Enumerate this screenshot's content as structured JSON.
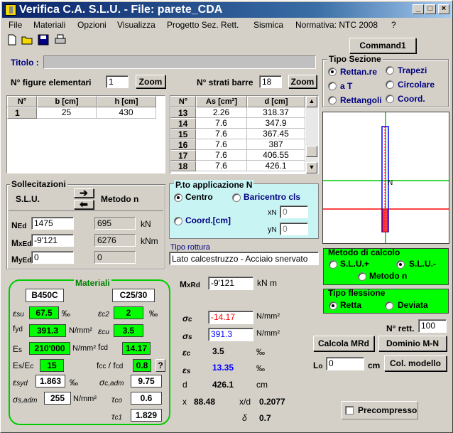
{
  "window": {
    "title": "Verifica C.A. S.L.U. - File: parete_CDA"
  },
  "menu": [
    "File",
    "Materiali",
    "Opzioni",
    "Visualizza",
    "Progetto Sez. Rett.",
    "Sismica",
    "Normativa: NTC 2008",
    "?"
  ],
  "command1": "Command1",
  "titolo_label": "Titolo :",
  "figure": {
    "label": "N° figure elementari",
    "value": "1",
    "zoom": "Zoom",
    "headers": [
      "N°",
      "b [cm]",
      "h [cm]"
    ],
    "rows": [
      [
        "1",
        "25",
        "430"
      ]
    ]
  },
  "strati": {
    "label": "N° strati barre",
    "value": "18",
    "zoom": "Zoom",
    "headers": [
      "N°",
      "As [cm²]",
      "d [cm]"
    ],
    "rows": [
      [
        "13",
        "2.26",
        "318.37"
      ],
      [
        "14",
        "7.6",
        "347.9"
      ],
      [
        "15",
        "7.6",
        "367.45"
      ],
      [
        "16",
        "7.6",
        "387"
      ],
      [
        "17",
        "7.6",
        "406.55"
      ],
      [
        "18",
        "7.6",
        "426.1"
      ]
    ]
  },
  "tipo_sezione": {
    "title": "Tipo Sezione",
    "options": [
      "Rettan.re",
      "Trapezi",
      "a T",
      "Circolare",
      "Rettangoli",
      "Coord."
    ],
    "selected": "Rettan.re"
  },
  "sollecitazioni": {
    "title": "Sollecitazioni",
    "slu": "S.L.U.",
    "metodo": "Metodo n",
    "ned": "1475",
    "mxed": "-9'121",
    "myed": "0",
    "ned_n": "695",
    "mxed_n": "6276",
    "myed_n": "0",
    "unit_kn": "kN",
    "unit_knm": "kNm"
  },
  "p_applicazione": {
    "title": "P.to applicazione N",
    "centro": "Centro",
    "baricentro": "Baricentro cls",
    "coord": "Coord.[cm]",
    "xn": "0",
    "yn": "0"
  },
  "tipo_rottura": {
    "title": "Tipo rottura",
    "value": "Lato calcestruzzo - Acciaio snervato"
  },
  "metodo_calcolo": {
    "title": "Metodo di calcolo",
    "slu_plus": "S.L.U.+",
    "slu_minus": "S.L.U.-",
    "metodo_n": "Metodo n"
  },
  "tipo_flessione": {
    "title": "Tipo flessione",
    "retta": "Retta",
    "deviata": "Deviata"
  },
  "materiali": {
    "title": "Materiali",
    "acciaio": "B450C",
    "cls": "C25/30",
    "esu": "67.5",
    "ec2": "2",
    "fyd": "391.3",
    "ecu": "3.5",
    "es": "210'000",
    "fcd": "14.17",
    "es_ec": "15",
    "fcc_fcd": "0.8",
    "esyd": "1.863",
    "sigma_c_adm": "9.75",
    "sigma_s_adm": "255",
    "tau_co": "0.6",
    "tau_c1": "1.829",
    "u_permille": "‰",
    "u_nmm2": "N/mm²"
  },
  "risultati": {
    "mxrd": "-9'121",
    "mxrd_unit": "kN m",
    "sigma_c": "-14.17",
    "sigma_s": "391.3",
    "eps_c": "3.5",
    "eps_s": "13.35",
    "d": "426.1",
    "d_unit": "cm",
    "x": "88.48",
    "x_d": "0.2077",
    "delta": "0.7"
  },
  "right": {
    "nrett_label": "N° rett.",
    "nrett": "100",
    "calcola": "Calcola MRd",
    "dominio": "Dominio M-N",
    "lo_label": "L",
    "lo_value": "0",
    "lo_unit": "cm",
    "col_modello": "Col. modello",
    "precompresso": "Precompresso"
  },
  "colors": {
    "green": "#00ff00",
    "red": "#ff0000",
    "blue": "#0000ff",
    "panel": "#d4d0c8",
    "cyan": "#c8f4f4"
  }
}
